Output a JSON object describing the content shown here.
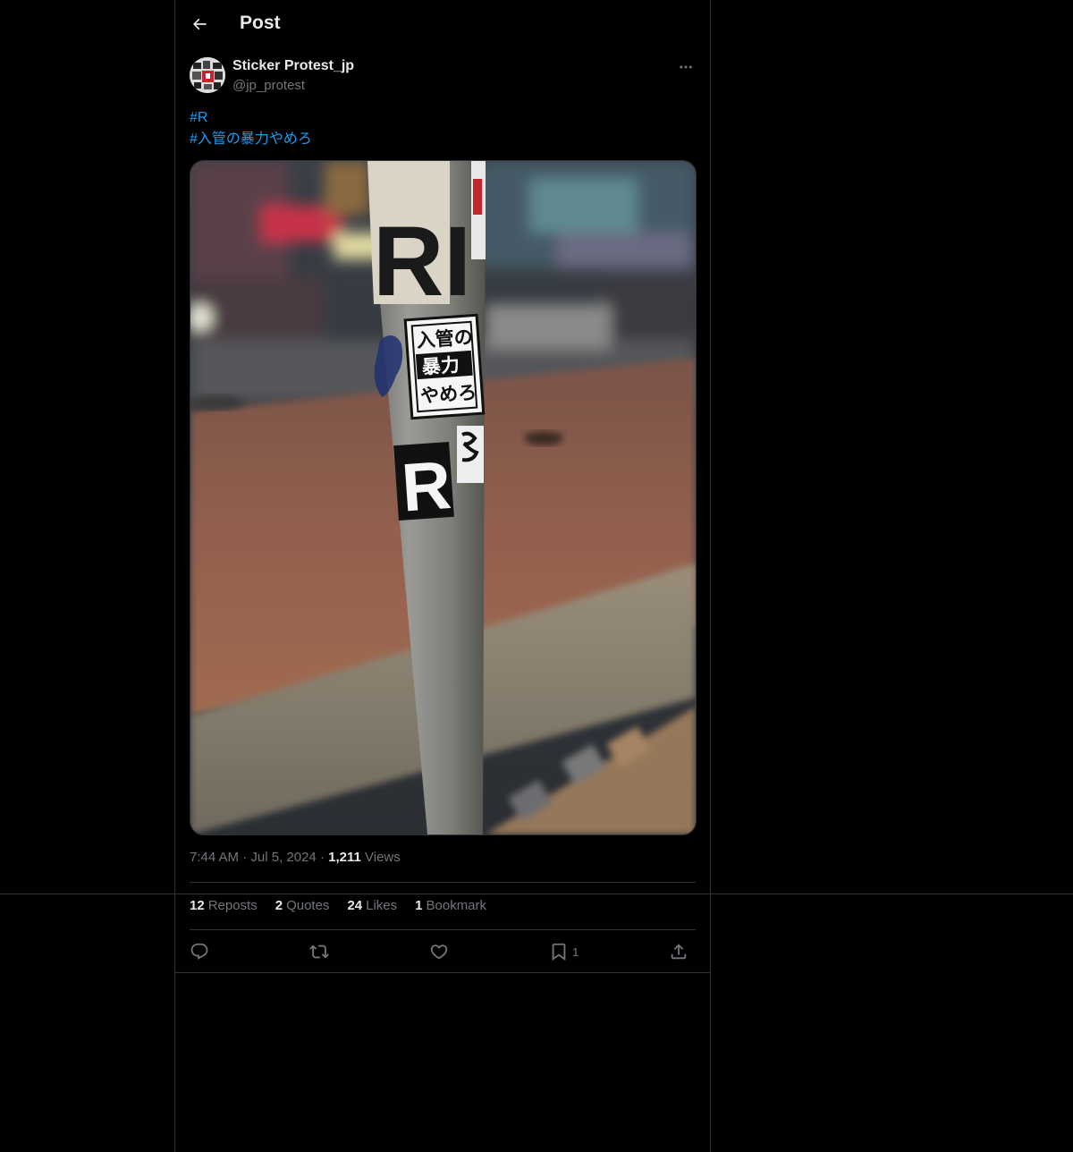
{
  "header": {
    "title": "Post"
  },
  "author": {
    "display_name": "Sticker Protest_jp",
    "handle": "@jp_protest"
  },
  "tweet": {
    "hashtags": [
      "#R",
      "#入管の暴力やめろ"
    ]
  },
  "media": {
    "sticker_text": [
      "入管の",
      "暴力",
      "やめろ"
    ],
    "sticker_r": "R",
    "sticker_top": "RI"
  },
  "meta": {
    "time": "7:44 AM",
    "dot1": "·",
    "date": "Jul 5, 2024",
    "dot2": "·",
    "views_count": "1,211",
    "views_label": "Views"
  },
  "stats": {
    "reposts_count": "12",
    "reposts_label": "Reposts",
    "quotes_count": "2",
    "quotes_label": "Quotes",
    "likes_count": "24",
    "likes_label": "Likes",
    "bookmarks_count": "1",
    "bookmarks_label": "Bookmark"
  },
  "actions": {
    "bookmark_count": "1"
  },
  "colors": {
    "background": "#000000",
    "text_primary": "#e7e9ea",
    "text_secondary": "#71767b",
    "link": "#1d9bf0",
    "border": "#2f3336"
  },
  "icons": {
    "back": "arrow-left-icon",
    "more": "more-horizontal-icon",
    "reply": "reply-icon",
    "repost": "repost-icon",
    "like": "heart-icon",
    "bookmark": "bookmark-icon",
    "share": "share-icon"
  }
}
